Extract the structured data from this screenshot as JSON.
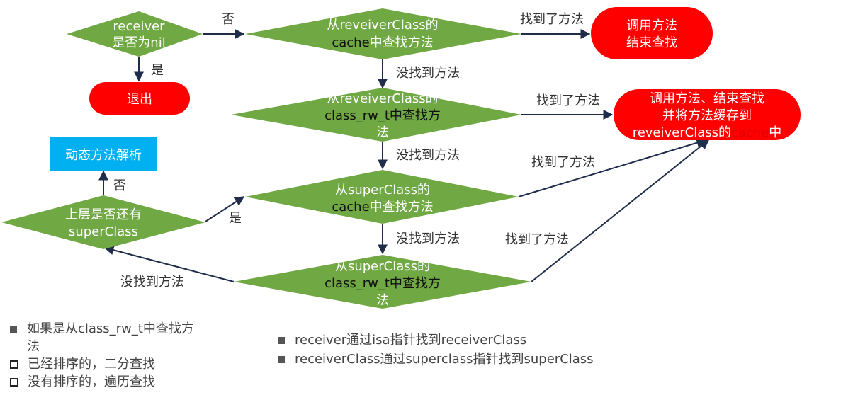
{
  "nodes": {
    "receiver_nil": {
      "line1": "receiver",
      "line2": "是否为nil"
    },
    "exit": {
      "label": "退出"
    },
    "cache_lookup": {
      "line1": "从reveiverClass的",
      "line2a": "cache",
      "line2b": "中查找方法"
    },
    "call_end": {
      "line1": "调用方法",
      "line2": "结束查找"
    },
    "rw_lookup": {
      "line1": "从reveiverClass的",
      "line2": "class_rw_t中查找方",
      "line3": "法"
    },
    "call_cache": {
      "line1": "调用方法、结束查找",
      "line2": "并将方法缓存到",
      "line3a": "reveiverClass的",
      "line3b": "cache",
      "line3c": "中"
    },
    "dynamic": {
      "label": "动态方法解析"
    },
    "has_super": {
      "line1": "上层是否还有",
      "line2": "superClass"
    },
    "super_cache": {
      "line1": "从superClass的",
      "line2a": "cache",
      "line2b": "中查找方法"
    },
    "super_rw": {
      "line1": "从superClass的",
      "line2": "class_rw_t中查找方",
      "line3": "法"
    }
  },
  "edges": {
    "no": "否",
    "yes": "是",
    "found": "找到了方法",
    "not_found": "没找到方法"
  },
  "notes_left": [
    {
      "bullet": "filled",
      "text": "如果是从class_rw_t中查找方",
      "cont": "法"
    },
    {
      "bullet": "hollow",
      "text": "已经排序的，二分查找"
    },
    {
      "bullet": "hollow",
      "text": "没有排序的，遍历查找"
    }
  ],
  "notes_right": [
    "receiver通过isa指针找到receiverClass",
    "receiverClass通过superclass指针找到superClass"
  ],
  "colors": {
    "diamond": "#70a844",
    "terminator": "#ff0000",
    "dynamic_box": "#00b0f0",
    "line": "#1f2d4a"
  }
}
